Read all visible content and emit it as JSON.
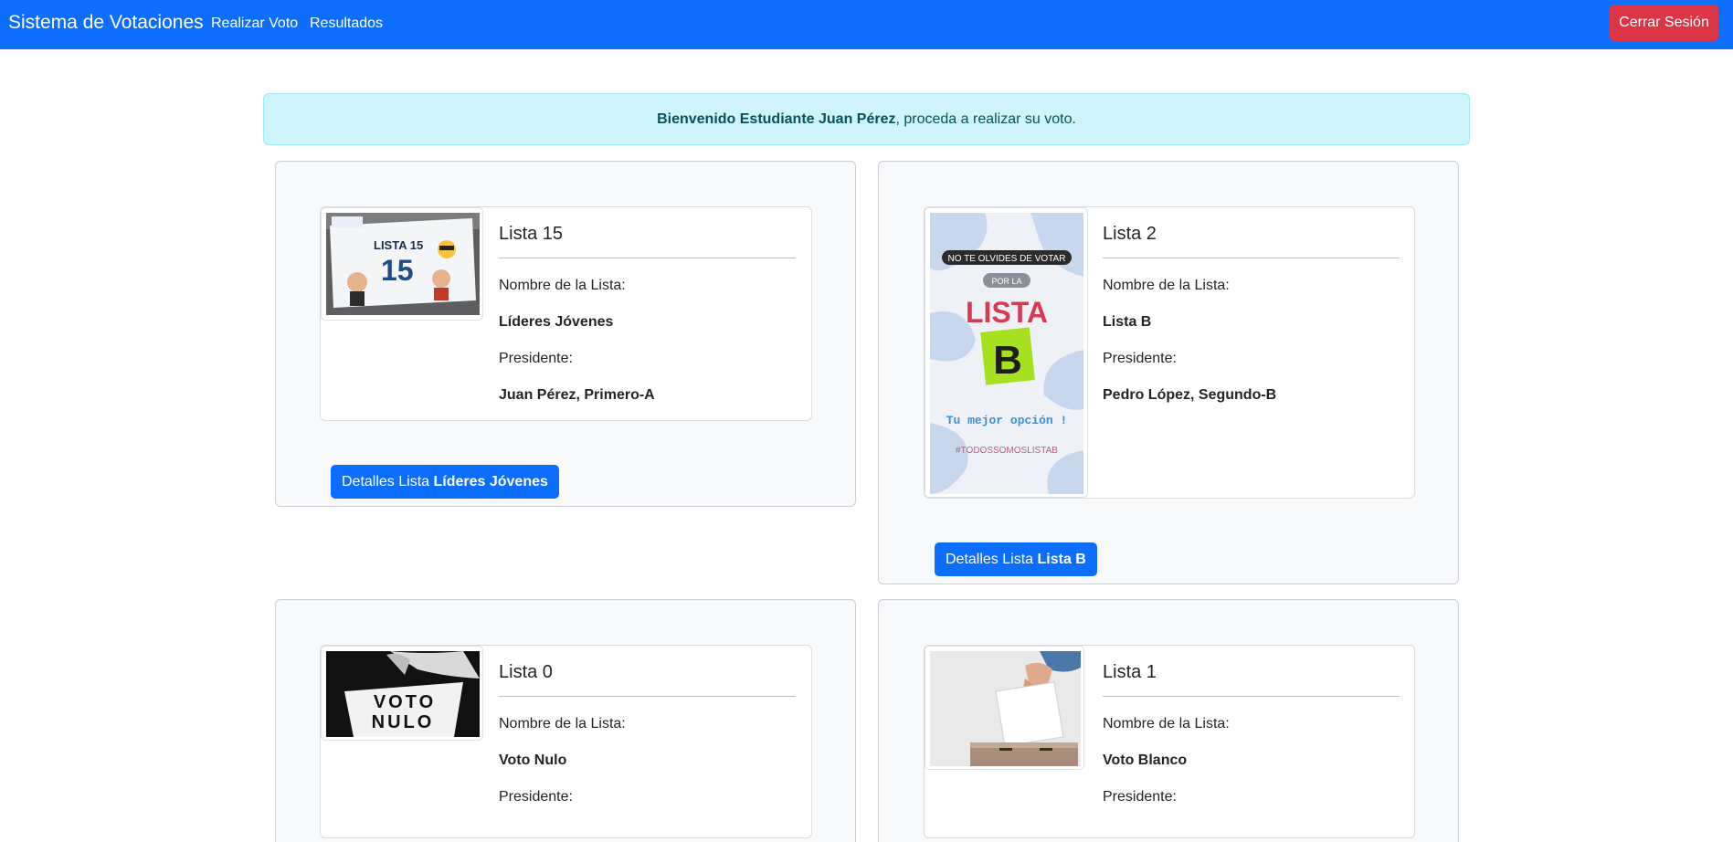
{
  "navbar": {
    "brand": "Sistema de Votaciones",
    "links": [
      "Realizar Voto",
      "Resultados"
    ],
    "logout": "Cerrar Sesión",
    "color": "#0d6efd"
  },
  "alert": {
    "bold": "Bienvenido Estudiante Juan Pérez",
    "rest": ", proceda a realizar su voto."
  },
  "field_labels": {
    "name": "Nombre de la Lista:",
    "president": "Presidente:"
  },
  "lists": [
    {
      "title": "Lista 15",
      "name": "Líderes Jóvenes",
      "president": "Juan Pérez, Primero-A",
      "button_prefix": "Detalles Lista",
      "button_name": "Líderes Jóvenes",
      "image": "lista-15-banner-image",
      "image_text": [
        "LISTA 15",
        "15"
      ]
    },
    {
      "title": "Lista 2",
      "name": "Lista B",
      "president": "Pedro López, Segundo-B",
      "button_prefix": "Detalles Lista",
      "button_name": "Lista B",
      "image": "lista-b-poster-image",
      "image_text": [
        "NO TE OLVIDES DE VOTAR",
        "POR LA",
        "LISTA",
        "B",
        "Tu mejor opción !",
        "#TODOSSOMOSLISTAB"
      ]
    },
    {
      "title": "Lista 0",
      "name": "Voto Nulo",
      "president": "",
      "image": "voto-nulo-image",
      "image_text": [
        "VOTO",
        "NULO"
      ]
    },
    {
      "title": "Lista 1",
      "name": "Voto Blanco",
      "president": "",
      "image": "ballot-box-image",
      "image_text": []
    }
  ]
}
